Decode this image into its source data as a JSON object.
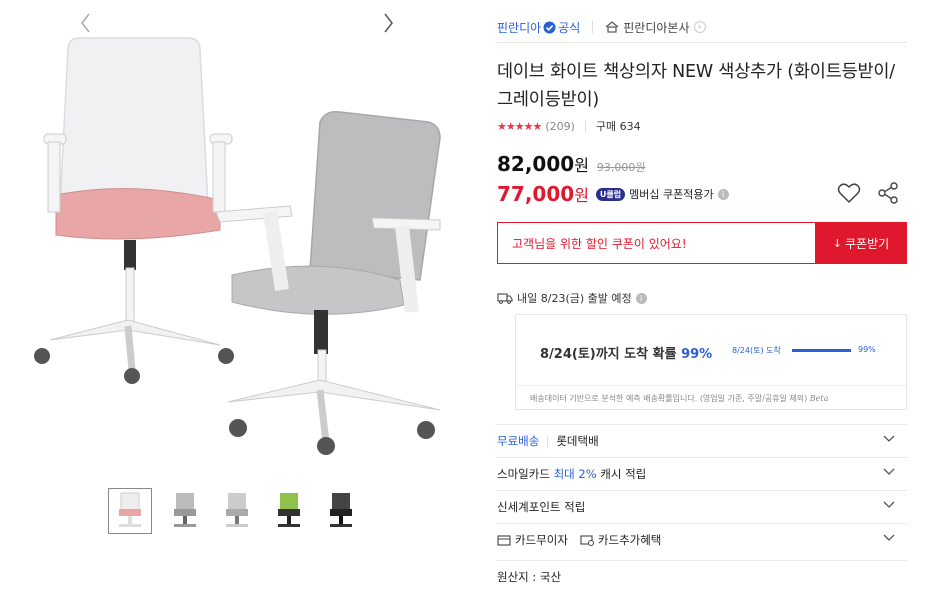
{
  "seller": {
    "name": "핀란디아",
    "official_label": "공식",
    "store_link": "핀란디아본사"
  },
  "product": {
    "title": "데이브 화이트 책상의자 NEW 색상추가 (화이트등받이/그레이등받이)",
    "stars": "★★★★★",
    "rating_count": "(209)",
    "purchase_count": "구매 634"
  },
  "price": {
    "current": "82,000",
    "unit": "원",
    "original": "93,000원",
    "sale": "77,000",
    "sale_unit": "원",
    "membership_badge": "U클럽",
    "coupon_text": "멤버십 쿠폰적용가"
  },
  "coupon": {
    "message": "고객님을 위한 할인 쿠폰이 있어요!",
    "button_label": "쿠폰받기"
  },
  "delivery": {
    "expected": "내일 8/23(금) 출발 예정",
    "prob_text": "8/24(토)까지 도착 확률",
    "prob_pct": "99%",
    "bar_label": "8/24(토) 도착",
    "bar_pct": "99%",
    "bar_value": 0.99,
    "note": "배송데이터 기반으로 분석한 예측 배송확률입니다. (영업일 기준, 주말/공휴일 제외)",
    "beta": "Beta"
  },
  "options": {
    "shipping_free": "무료배송",
    "shipping_carrier": "롯데택배",
    "smilecard_prefix": "스마일카드",
    "smilecard_rate": "최대 2%",
    "smilecard_suffix": "캐시 적립",
    "shinsegae": "신세계포인트 적립",
    "card_interest": "카드무이자",
    "card_benefit": "카드추가혜택",
    "origin": "원산지 : 국산"
  },
  "colors": {
    "accent_red": "#e0182d",
    "accent_blue": "#2b5fd6"
  }
}
